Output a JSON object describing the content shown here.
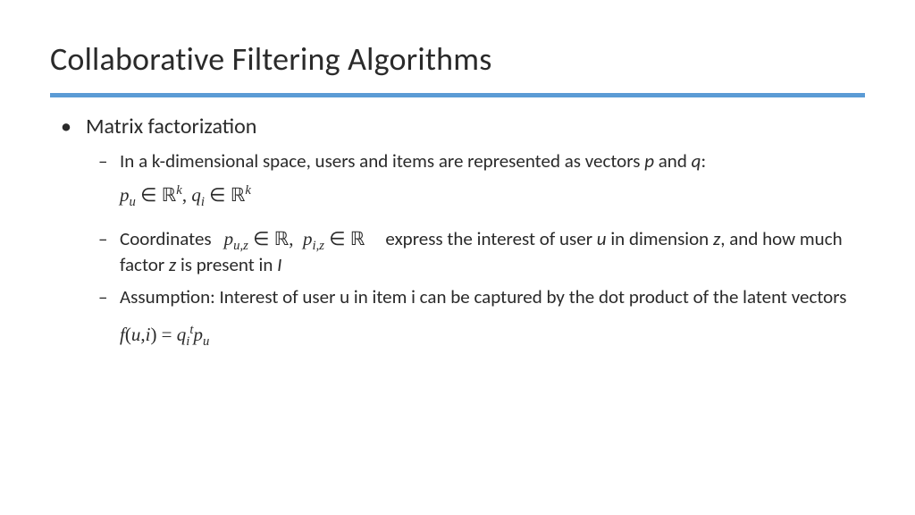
{
  "title": "Collaborative Filtering Algorithms",
  "bullets": {
    "l1": "Matrix factorization",
    "l2a_pre": "In a k-dimensional space, users and items are represented as vectors ",
    "l2a_p": "p",
    "l2a_mid": " and ",
    "l2a_q": "q",
    "l2a_post": ":",
    "l2b_pre": "Coordinates ",
    "l2b_post1": " express the interest of user ",
    "l2b_u": "u",
    "l2b_post2": " in dimension ",
    "l2b_z": "z",
    "l2b_post3": ", and how much factor ",
    "l2b_z2": "z",
    "l2b_post4": " is present in ",
    "l2b_I": "I",
    "l2c": "Assumption: Interest of user u in item i can be captured by the dot product of the latent vectors"
  },
  "formulas": {
    "block1_pu": "p",
    "block1_u": "u",
    "block1_in": " ∈ ",
    "block1_R": "ℝ",
    "block1_k": "k",
    "block1_sep": ", ",
    "block1_qi": "q",
    "block1_i": "i",
    "inline_puz_p": "p",
    "inline_puz_sub": "u,z",
    "inline_in": " ∈ ",
    "inline_R": "ℝ",
    "inline_sep": ", ",
    "inline_piz_p": "p",
    "inline_piz_sub": "i,z",
    "block2_f": "f",
    "block2_paren": "(",
    "block2_u": "u",
    "block2_comma": ",",
    "block2_i": "i",
    "block2_paren2": ") = ",
    "block2_q": "q",
    "block2_qsub": "i",
    "block2_qsup": "t",
    "block2_p": "p",
    "block2_psub": "u"
  }
}
